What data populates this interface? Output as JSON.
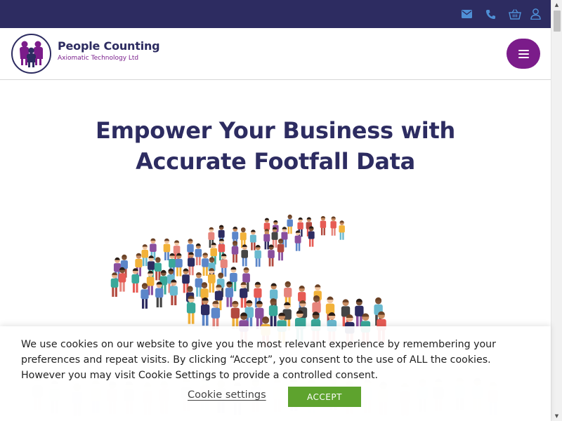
{
  "colors": {
    "topbar_bg": "#2d2c61",
    "icon_blue": "#4f8fd6",
    "brand_purple": "#7b1c8a",
    "heading_navy": "#2d2c61",
    "accept_green": "#5ea32e"
  },
  "topbar": {
    "icons": [
      "envelope-icon",
      "phone-icon",
      "basket-icon",
      "user-icon"
    ]
  },
  "header": {
    "brand_name": "People Counting",
    "brand_sub": "Axiomatic Technology Ltd",
    "logo_icon": "family-icon",
    "menu_icon": "hamburger-icon"
  },
  "hero": {
    "title_line1": "Empower Your Business with",
    "title_line2": "Accurate Footfall Data",
    "image": "crowd-illustration"
  },
  "cookie": {
    "text": "We use cookies on our website to give you the most relevant experience by remembering your preferences and repeat visits. By clicking “Accept”, you consent to the use of ALL the cookies. However you may visit Cookie Settings to provide a controlled consent.",
    "settings_label": "Cookie settings",
    "accept_label": "ACCEPT"
  }
}
